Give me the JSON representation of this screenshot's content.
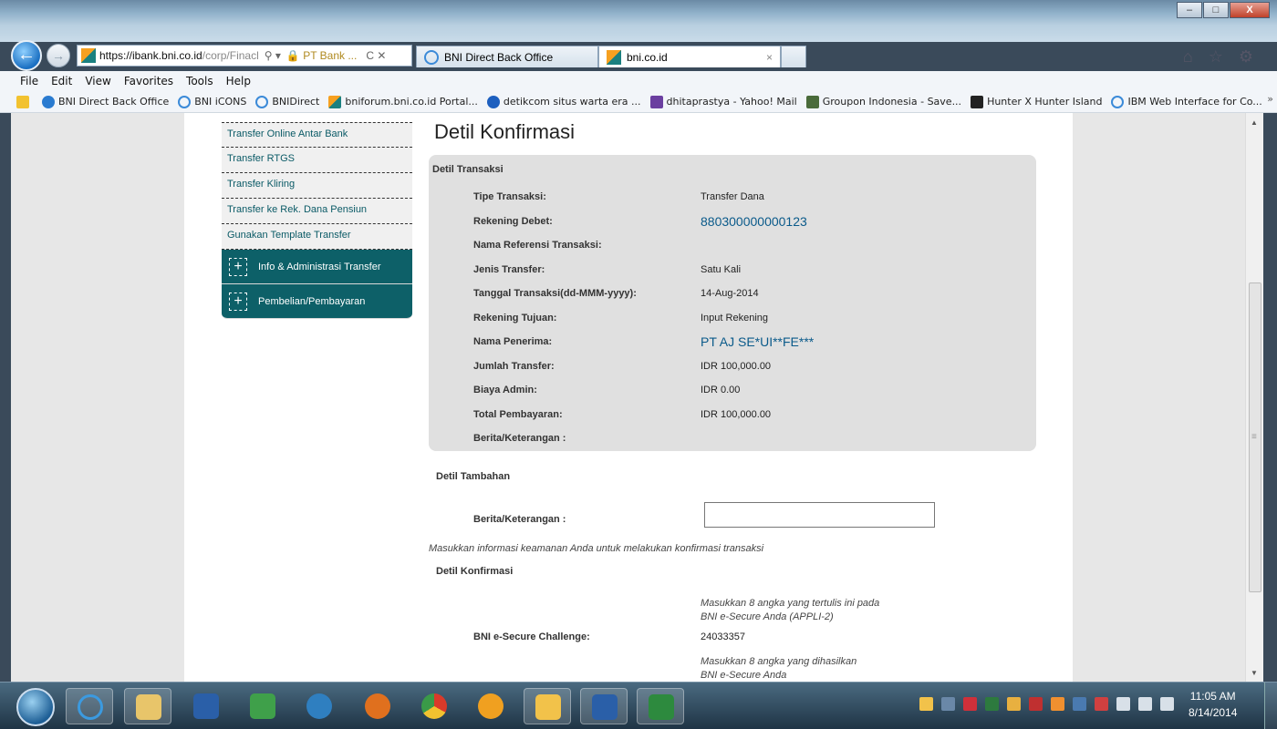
{
  "window": {
    "minimize": "–",
    "maximize": "□",
    "close": "X"
  },
  "browser": {
    "url_host": "https://ibank.bni.co.id",
    "url_path": "/corp/Finacl",
    "search_glyph": "⚲ ▾",
    "lock_label": "🔒 PT Bank ...",
    "refresh_stop": "C ✕",
    "tabs": [
      {
        "label": "BNI Direct Back Office"
      },
      {
        "label": "bni.co.id",
        "close": "×"
      }
    ],
    "toolbar_icons": "⌂ ☆ ⚙"
  },
  "menubar": [
    "File",
    "Edit",
    "View",
    "Favorites",
    "Tools",
    "Help"
  ],
  "favorites": [
    "BNI Direct Back Office",
    "BNI iCONS",
    "BNIDirect",
    "bniforum.bni.co.id Portal...",
    "detikcom situs warta era ...",
    "dhitaprastya - Yahoo! Mail",
    "Groupon Indonesia - Save...",
    "Hunter X Hunter Island",
    "IBM Web Interface for Co..."
  ],
  "favorites_more": "»",
  "sidebar": {
    "items": [
      "Transfer Online Antar Bank",
      "Transfer RTGS",
      "Transfer Kliring",
      "Transfer ke Rek. Dana Pensiun",
      "Gunakan Template Transfer"
    ],
    "groups": [
      {
        "icon": "+",
        "label": "Info & Administrasi Transfer"
      },
      {
        "icon": "+",
        "label": "Pembelian/Pembayaran"
      }
    ]
  },
  "page": {
    "title": "Detil Konfirmasi",
    "transaction_section": "Detil Transaksi",
    "rows": [
      {
        "label": "Tipe Transaksi:",
        "value": "Transfer Dana"
      },
      {
        "label": "Rekening Debet:",
        "value": "880300000000123"
      },
      {
        "label": "Nama Referensi Transaksi:",
        "value": ""
      },
      {
        "label": "Jenis Transfer:",
        "value": "Satu Kali"
      },
      {
        "label": "Tanggal Transaksi(dd-MMM-yyyy):",
        "value": "14-Aug-2014"
      },
      {
        "label": "Rekening Tujuan:",
        "value": "Input Rekening"
      },
      {
        "label": "Nama Penerima:",
        "value": "PT AJ SE*UI**FE***"
      },
      {
        "label": "Jumlah Transfer:",
        "value": "IDR 100,000.00"
      },
      {
        "label": "Biaya Admin:",
        "value": "IDR 0.00"
      },
      {
        "label": "Total Pembayaran:",
        "value": "IDR 100,000.00"
      },
      {
        "label": "Berita/Keterangan :",
        "value": ""
      }
    ],
    "additional_section": "Detil Tambahan",
    "berita_label": "Berita/Keterangan :",
    "berita_value": "",
    "security_note": "Masukkan informasi keamanan Anda untuk melakukan konfirmasi transaksi",
    "confirm_section": "Detil Konfirmasi",
    "challenge_note_1": "Masukkan 8 angka yang tertulis ini pada",
    "challenge_note_2": "BNI e-Secure Anda (APPLI-2)",
    "challenge_label": "BNI e-Secure Challenge:",
    "challenge_value": "24033357",
    "response_note_1": "Masukkan 8 angka yang dihasilkan",
    "response_note_2": "BNI e-Secure Anda"
  },
  "taskbar": {
    "time": "11:05 AM",
    "date": "8/14/2014"
  },
  "colors": {
    "teal": "#0d6068",
    "link_blue": "#0a5a8a",
    "panel_gray": "#e0e0e0"
  }
}
